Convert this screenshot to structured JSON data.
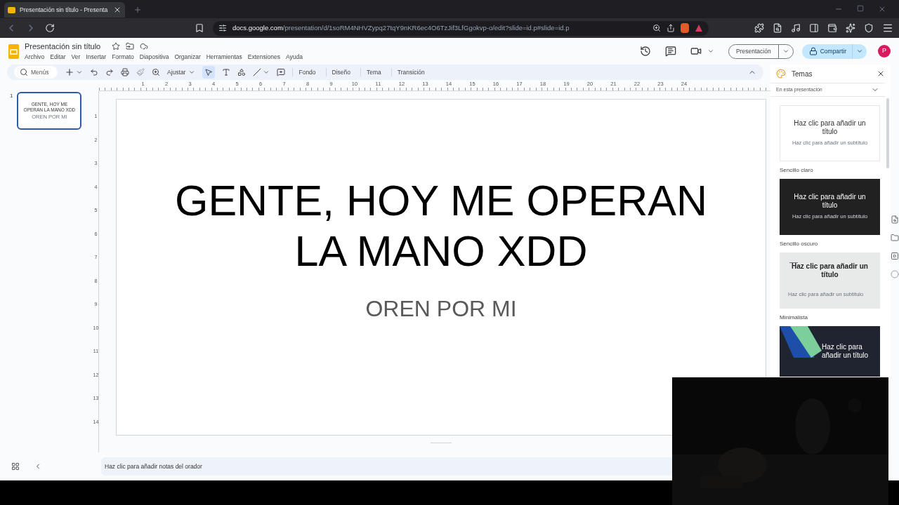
{
  "browser": {
    "tab_title": "Presentación sin título - Presenta",
    "url_host": "docs.google.com",
    "url_path": "/presentation/d/1soRM4NHVZypq27tqY9nKR6ec4O6TzJif3LfGgokvp-o/edit?slide=id.p#slide=id.p"
  },
  "app": {
    "title": "Presentación sin título",
    "menus": [
      "Archivo",
      "Editar",
      "Ver",
      "Insertar",
      "Formato",
      "Diapositiva",
      "Organizar",
      "Herramientas",
      "Extensiones",
      "Ayuda"
    ],
    "present_button": "Presentación",
    "share_button": "Compartir",
    "avatar": "P"
  },
  "toolbar": {
    "search": "Menús",
    "zoom": "Ajustar",
    "buttons": [
      "Fondo",
      "Diseño",
      "Tema",
      "Transición"
    ]
  },
  "slides": [
    {
      "number": "1",
      "title": "GENTE, HOY ME OPERAN LA MANO XDD",
      "subtitle": "OREN POR MI",
      "selected": true
    }
  ],
  "ruler": {
    "h_ticks": [
      "1",
      "2",
      "3",
      "4",
      "5",
      "6",
      "7",
      "8",
      "9",
      "10",
      "11",
      "12",
      "13",
      "14",
      "15",
      "16",
      "17",
      "18",
      "19",
      "20",
      "21",
      "22",
      "23",
      "24"
    ],
    "v_ticks": [
      "1",
      "2",
      "3",
      "4",
      "5",
      "6",
      "7",
      "8",
      "9",
      "10",
      "11",
      "12",
      "13",
      "14"
    ]
  },
  "slide": {
    "title": "GENTE, HOY ME OPERAN LA MANO XDD",
    "subtitle": "OREN POR MI"
  },
  "notes": {
    "placeholder": "Haz clic para añadir notas del orador"
  },
  "themes_panel": {
    "title": "Temas",
    "filter": "En esta presentación",
    "themes": [
      {
        "kind": "light",
        "title": "Haz clic para añadir un título",
        "subtitle": "Haz clic para añadir un subtítulo",
        "name": "Sencillo claro"
      },
      {
        "kind": "dark",
        "title": "Haz clic para añadir un título",
        "subtitle": "Haz clic para añadir un subtítulo",
        "name": "Sencillo oscuro"
      },
      {
        "kind": "minimal",
        "title": "Haz clic para añadir un título",
        "subtitle": "Haz clic para añadir un subtítulo",
        "name": "Minimalista"
      },
      {
        "kind": "geometric",
        "title": "Haz clic para añadir un título"
      }
    ]
  }
}
